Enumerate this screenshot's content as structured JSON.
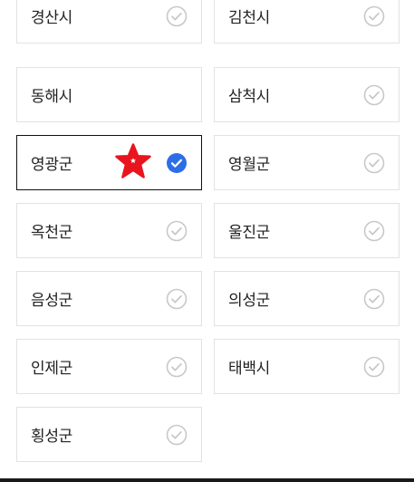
{
  "regions": [
    {
      "label": "경산시",
      "selected": false
    },
    {
      "label": "김천시",
      "selected": false
    },
    {
      "label": "동해시",
      "selected": false
    },
    {
      "label": "삼척시",
      "selected": false
    },
    {
      "label": "영광군",
      "selected": true
    },
    {
      "label": "영월군",
      "selected": false
    },
    {
      "label": "옥천군",
      "selected": false
    },
    {
      "label": "울진군",
      "selected": false
    },
    {
      "label": "음성군",
      "selected": false
    },
    {
      "label": "의성군",
      "selected": false
    },
    {
      "label": "인제군",
      "selected": false
    },
    {
      "label": "태백시",
      "selected": false
    },
    {
      "label": "횡성군",
      "selected": false
    }
  ],
  "colors": {
    "check_selected": "#2d6ee8",
    "check_unselected": "#c8c8c8",
    "star": "#e8141e",
    "border_selected": "#111111",
    "border": "#e2e2e2"
  },
  "icons": {
    "check": "check-circle-icon",
    "marker": "star-icon"
  }
}
